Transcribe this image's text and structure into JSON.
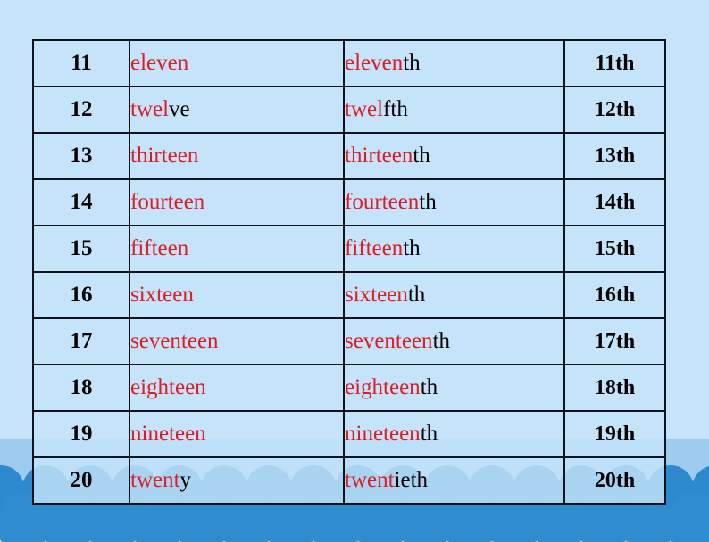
{
  "colors": {
    "page_background": "#c5e4f9",
    "horizon_band": "#9ecbf0",
    "dome": "#2e8ace",
    "stem_red": "#e01b24",
    "suffix_black": "#000000",
    "table_border": "#10131c"
  },
  "table": {
    "columns": [
      "cardinal_number",
      "cardinal_word",
      "ordinal_word",
      "ordinal_number"
    ],
    "rows": [
      {
        "cardinal_number": "11",
        "cardinal_word": {
          "stem": "eleven",
          "suffix": ""
        },
        "ordinal_word": {
          "stem": "eleven",
          "suffix": "th"
        },
        "ordinal_number": "11th"
      },
      {
        "cardinal_number": "12",
        "cardinal_word": {
          "stem": "twel",
          "suffix": "ve"
        },
        "ordinal_word": {
          "stem": "twel",
          "suffix": "fth"
        },
        "ordinal_number": "12th"
      },
      {
        "cardinal_number": "13",
        "cardinal_word": {
          "stem": "thirteen",
          "suffix": ""
        },
        "ordinal_word": {
          "stem": "thirteen",
          "suffix": "th"
        },
        "ordinal_number": "13th"
      },
      {
        "cardinal_number": "14",
        "cardinal_word": {
          "stem": "fourteen",
          "suffix": ""
        },
        "ordinal_word": {
          "stem": "fourteen",
          "suffix": "th"
        },
        "ordinal_number": "14th"
      },
      {
        "cardinal_number": "15",
        "cardinal_word": {
          "stem": "fifteen",
          "suffix": ""
        },
        "ordinal_word": {
          "stem": "fifteen",
          "suffix": "th"
        },
        "ordinal_number": "15th"
      },
      {
        "cardinal_number": "16",
        "cardinal_word": {
          "stem": "sixteen",
          "suffix": ""
        },
        "ordinal_word": {
          "stem": "sixteen",
          "suffix": "th"
        },
        "ordinal_number": "16th"
      },
      {
        "cardinal_number": "17",
        "cardinal_word": {
          "stem": "seventeen",
          "suffix": ""
        },
        "ordinal_word": {
          "stem": "seventeen",
          "suffix": "th"
        },
        "ordinal_number": "17th"
      },
      {
        "cardinal_number": "18",
        "cardinal_word": {
          "stem": "eighteen",
          "suffix": ""
        },
        "ordinal_word": {
          "stem": "eighteen",
          "suffix": "th"
        },
        "ordinal_number": "18th"
      },
      {
        "cardinal_number": "19",
        "cardinal_word": {
          "stem": "nineteen",
          "suffix": ""
        },
        "ordinal_word": {
          "stem": "nineteen",
          "suffix": "th"
        },
        "ordinal_number": "19th"
      },
      {
        "cardinal_number": "20",
        "cardinal_word": {
          "stem": "twent",
          "suffix": "y"
        },
        "ordinal_word": {
          "stem": "twent",
          "suffix": "ieth"
        },
        "ordinal_number": "20th"
      }
    ]
  },
  "background": {
    "dome_count_per_row": 17,
    "dome_rows": 2
  }
}
